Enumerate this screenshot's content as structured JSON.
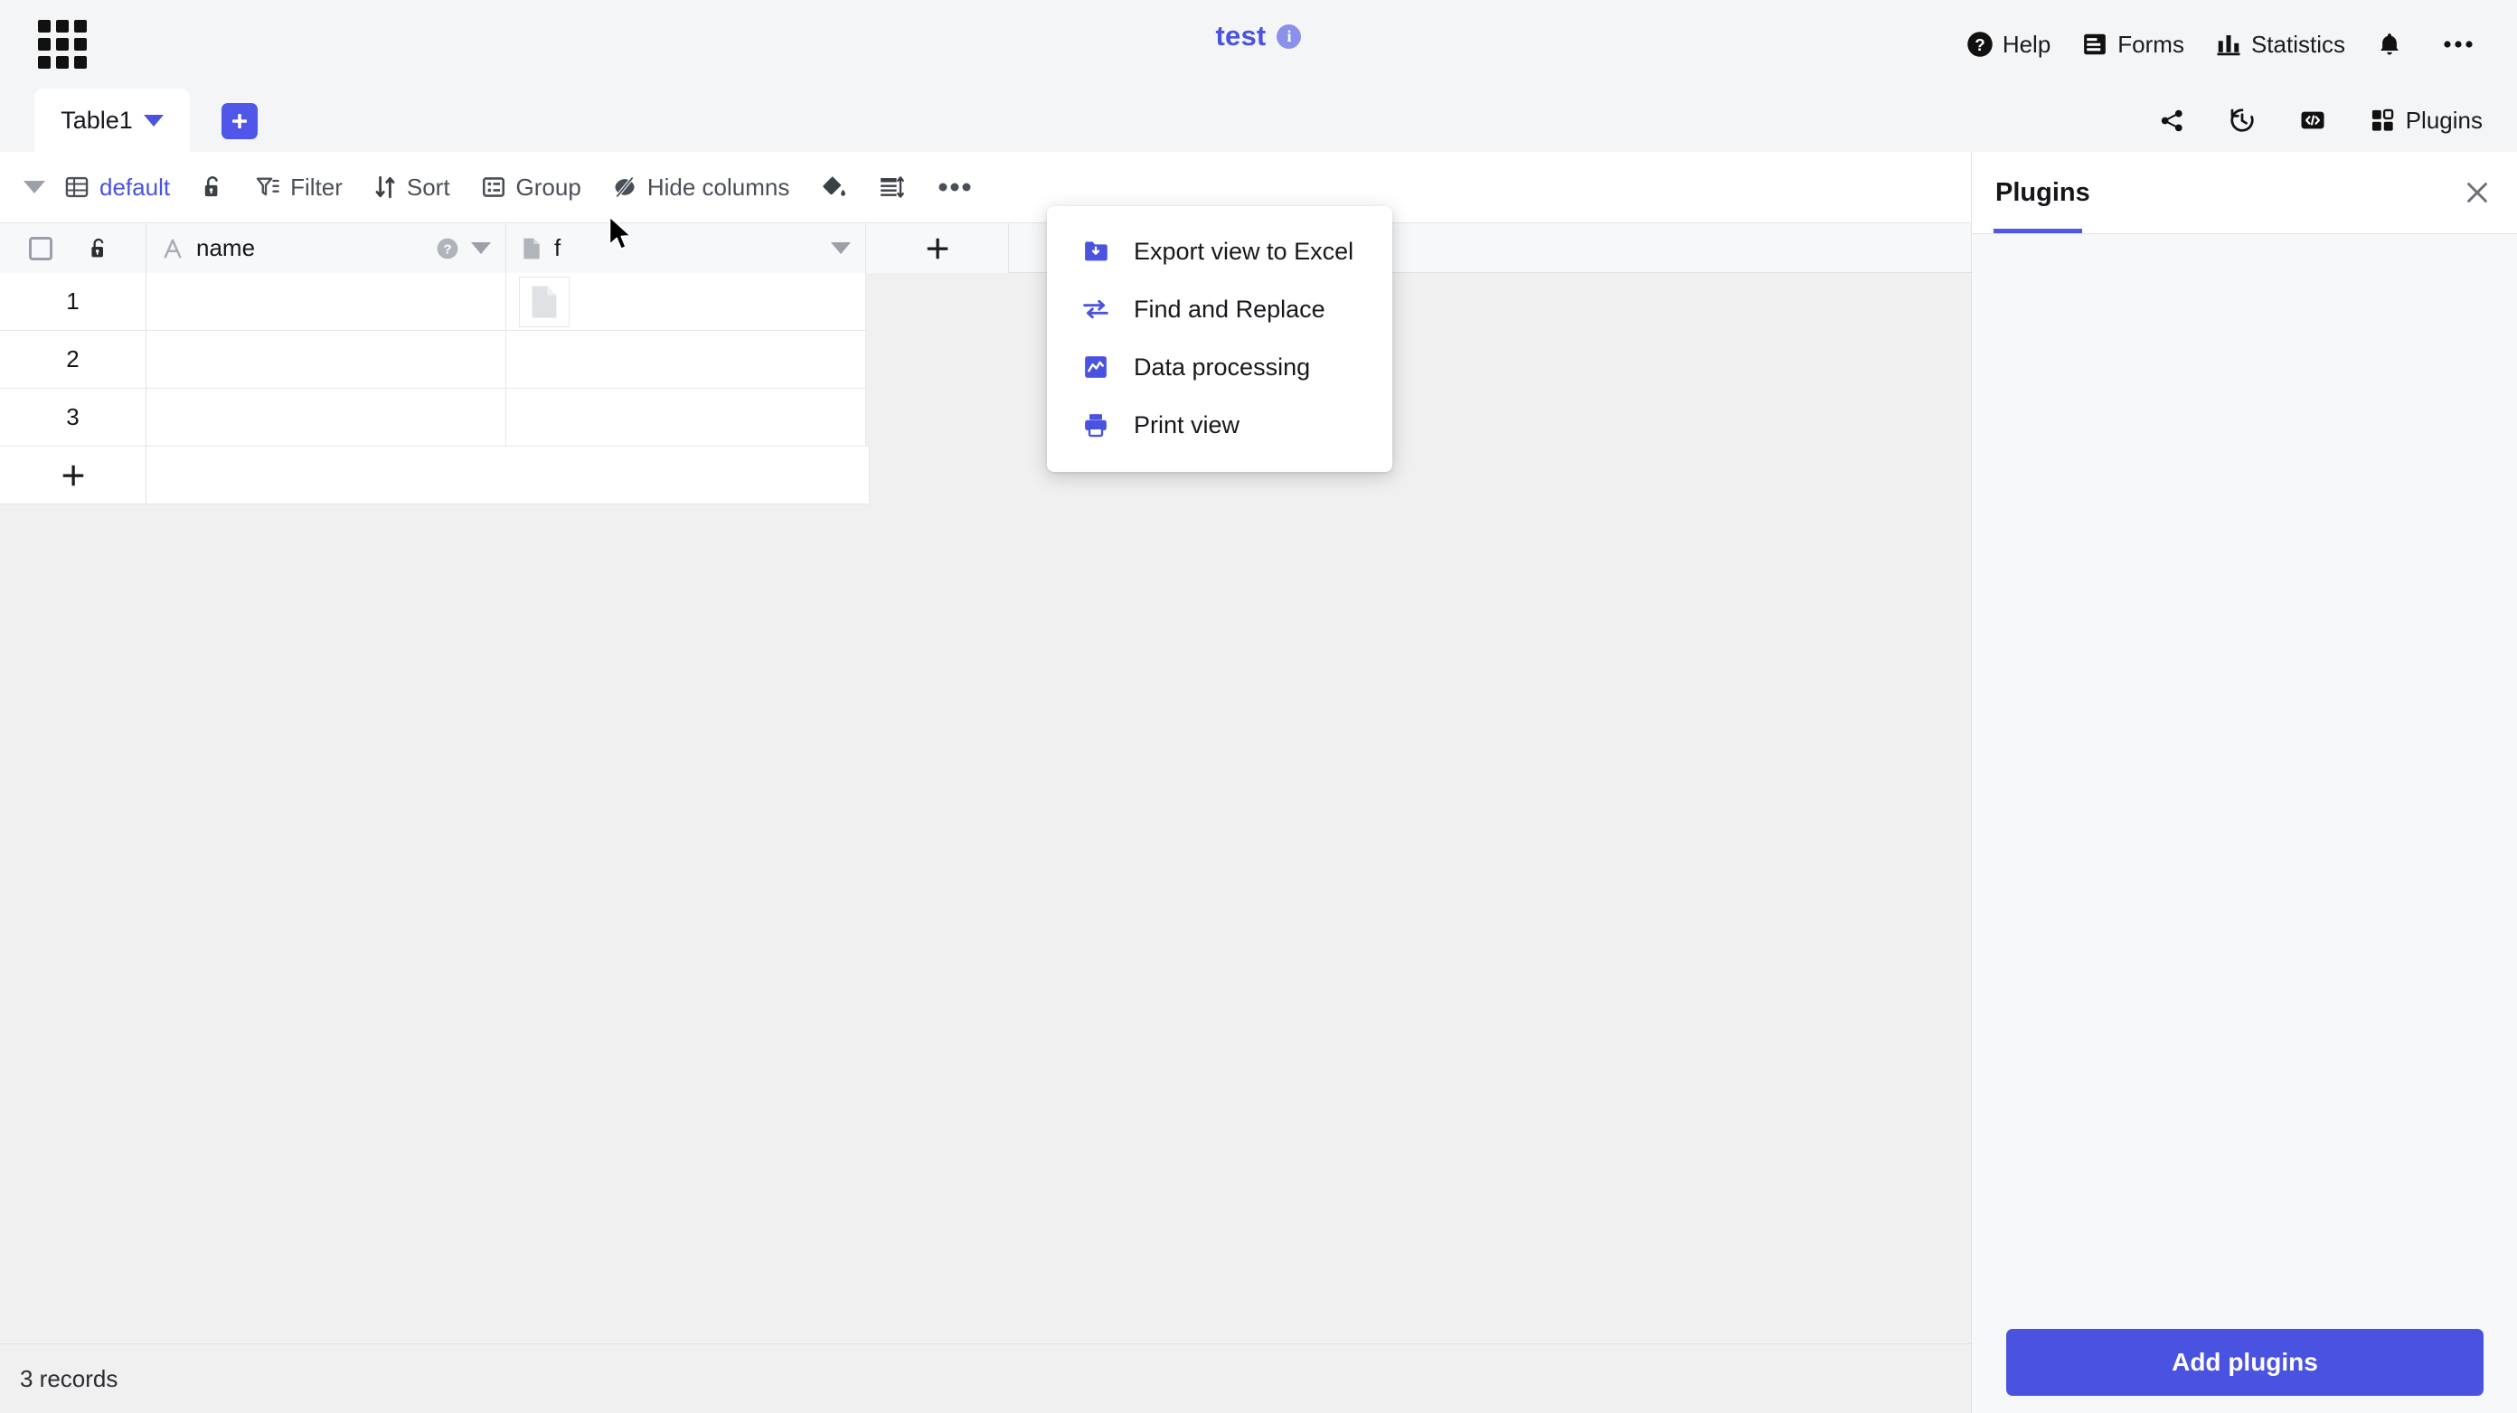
{
  "window": {
    "doc_title": "test",
    "info_icon": "info-circle-icon",
    "waffle_icon": "apps-grid-icon"
  },
  "top_actions": [
    {
      "label": "Help",
      "icon": "help-circle-icon"
    },
    {
      "label": "Forms",
      "icon": "form-list-icon"
    },
    {
      "label": "Statistics",
      "icon": "bar-chart-icon"
    },
    {
      "label": "",
      "icon": "bell-icon"
    },
    {
      "label": "",
      "icon": "more-horizontal-icon"
    }
  ],
  "tabs": {
    "active": "Table1",
    "add_label": "+",
    "right_actions": [
      {
        "label": "",
        "icon": "share-icon"
      },
      {
        "label": "",
        "icon": "history-clock-icon"
      },
      {
        "label": "",
        "icon": "code-brackets-icon"
      },
      {
        "label": "Plugins",
        "icon": "plugins-grid-icon"
      }
    ]
  },
  "toolbar": {
    "collapse_icon": "caret-down-icon",
    "view_icon": "table-view-icon",
    "view_name": "default",
    "lock_icon": "unlock-icon",
    "items": [
      {
        "label": "Filter",
        "icon": "filter-icon"
      },
      {
        "label": "Sort",
        "icon": "sort-icon"
      },
      {
        "label": "Group",
        "icon": "group-icon"
      },
      {
        "label": "Hide columns",
        "icon": "hide-eye-icon"
      }
    ],
    "paint_icon": "paint-bucket-icon",
    "row_height_icon": "row-height-icon",
    "more_icon": "more-horizontal-icon"
  },
  "menu": {
    "items": [
      {
        "label": "Export view to Excel",
        "icon": "export-folder-icon"
      },
      {
        "label": "Find and Replace",
        "icon": "find-replace-icon"
      },
      {
        "label": "Data processing",
        "icon": "data-processing-icon"
      },
      {
        "label": "Print view",
        "icon": "printer-icon"
      }
    ]
  },
  "grid": {
    "select_all_icon": "checkbox-icon",
    "lock_icon": "unlock-icon",
    "add_column_label": "+",
    "columns": [
      {
        "name": "name",
        "type_icon": "text-A-icon",
        "has_help": true,
        "help_icon": "question-circle-icon"
      },
      {
        "name": "f",
        "type_icon": "file-icon",
        "has_help": false,
        "help_icon": ""
      }
    ],
    "rows": [
      {
        "num": "1",
        "cells": [
          "",
          "file-attachment"
        ]
      },
      {
        "num": "2",
        "cells": [
          "",
          ""
        ]
      },
      {
        "num": "3",
        "cells": [
          "",
          ""
        ]
      }
    ],
    "add_row_label": "+"
  },
  "footer": {
    "record_count": "3 records"
  },
  "panel": {
    "title": "Plugins",
    "close_icon": "close-x-icon",
    "add_button": "Add plugins"
  },
  "colors": {
    "accent": "#4a52e0",
    "accent_button": "#4f56e8",
    "page_bg": "#f4f5f7",
    "grid_bg": "#f0f0f0",
    "header_bg": "#f7f8f9",
    "text": "#15161a",
    "muted_text": "#4a4f57"
  }
}
